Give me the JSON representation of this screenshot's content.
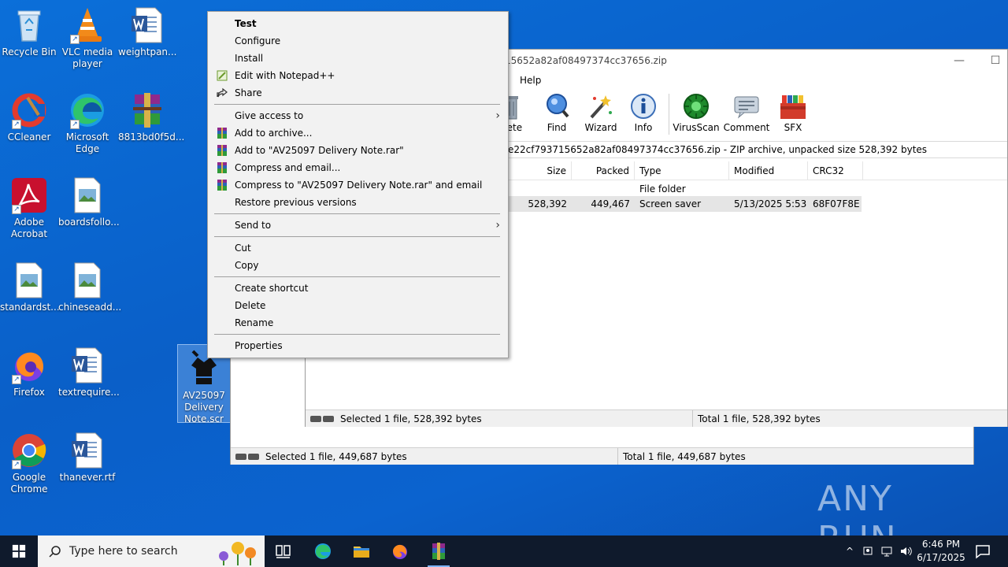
{
  "desktop": {
    "icons": [
      {
        "label": "Recycle Bin"
      },
      {
        "label": "VLC media player"
      },
      {
        "label": "weightpan..."
      },
      {
        "label": "CCleaner"
      },
      {
        "label": "Microsoft Edge"
      },
      {
        "label": "8813bd0f5d..."
      },
      {
        "label": "Adobe Acrobat"
      },
      {
        "label": "boardsfollo..."
      },
      {
        "label": "standardst..."
      },
      {
        "label": "chineseadd..."
      },
      {
        "label": "Firefox"
      },
      {
        "label": "textrequire..."
      },
      {
        "label": "AV25097 Delivery Note.scr"
      },
      {
        "label": "Google Chrome"
      },
      {
        "label": "thanever.rtf"
      }
    ]
  },
  "winrar_front": {
    "title": "15652a82af08497374cc37656.zip",
    "menu": {
      "help": "Help"
    },
    "toolbar": {
      "delete": "elete",
      "find": "Find",
      "wizard": "Wizard",
      "info": "Info",
      "virusscan": "VirusScan",
      "comment": "Comment",
      "sfx": "SFX"
    },
    "path": "e22cf793715652a82af08497374cc37656.zip - ZIP archive, unpacked size 528,392 bytes",
    "columns": {
      "size": "Size",
      "packed": "Packed",
      "type": "Type",
      "modified": "Modified",
      "crc": "CRC32"
    },
    "rows": [
      {
        "size": "",
        "packed": "",
        "type": "File folder",
        "modified": "",
        "crc": ""
      },
      {
        "size": "528,392",
        "packed": "449,467",
        "type": "Screen saver",
        "modified": "5/13/2025 5:53 ...",
        "crc": "68F07F8E"
      }
    ],
    "status_left": "Selected 1 file, 528,392 bytes",
    "status_right": "Total 1 file, 528,392 bytes"
  },
  "winrar_back": {
    "status_left": "Selected 1 file, 449,687 bytes",
    "status_right": "Total 1 file, 449,687 bytes"
  },
  "context_menu": {
    "test": "Test",
    "configure": "Configure",
    "install": "Install",
    "edit_notepad": "Edit with Notepad++",
    "share": "Share",
    "give_access": "Give access to",
    "add_archive": "Add to archive...",
    "add_to_rar": "Add to \"AV25097 Delivery Note.rar\"",
    "compress_email": "Compress and email...",
    "compress_to_rar_email": "Compress to \"AV25097 Delivery Note.rar\" and email",
    "restore": "Restore previous versions",
    "send_to": "Send to",
    "cut": "Cut",
    "copy": "Copy",
    "create_shortcut": "Create shortcut",
    "delete": "Delete",
    "rename": "Rename",
    "properties": "Properties"
  },
  "taskbar": {
    "search_placeholder": "Type here to search",
    "time": "6:46 PM",
    "date": "6/17/2025"
  },
  "watermark": "ANY RUN"
}
